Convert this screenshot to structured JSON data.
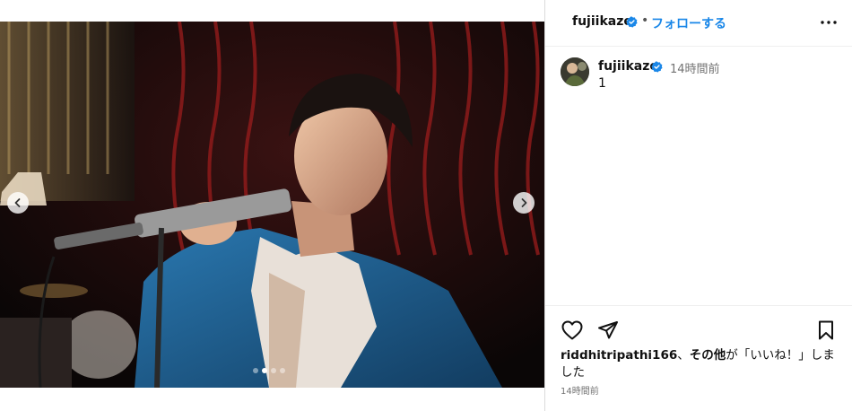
{
  "header": {
    "username": "fujiikaze",
    "separator": "•",
    "follow_label": "フォローする",
    "more_icon": "more-horizontal-icon"
  },
  "caption": {
    "username": "fujiikaze",
    "time": "14時間前",
    "text": "1"
  },
  "carousel": {
    "slide_count": 4,
    "active_index": 1
  },
  "likes": {
    "user": "riddhitripathi166",
    "sep": "、",
    "others": "その他",
    "suffix": "が「いいね！」しました"
  },
  "post_time": "14時間前",
  "colors": {
    "verified": "#1a87e8",
    "follow": "#1a87e8",
    "jacket": "#1d5a8a",
    "curtain": "#6a1414"
  }
}
